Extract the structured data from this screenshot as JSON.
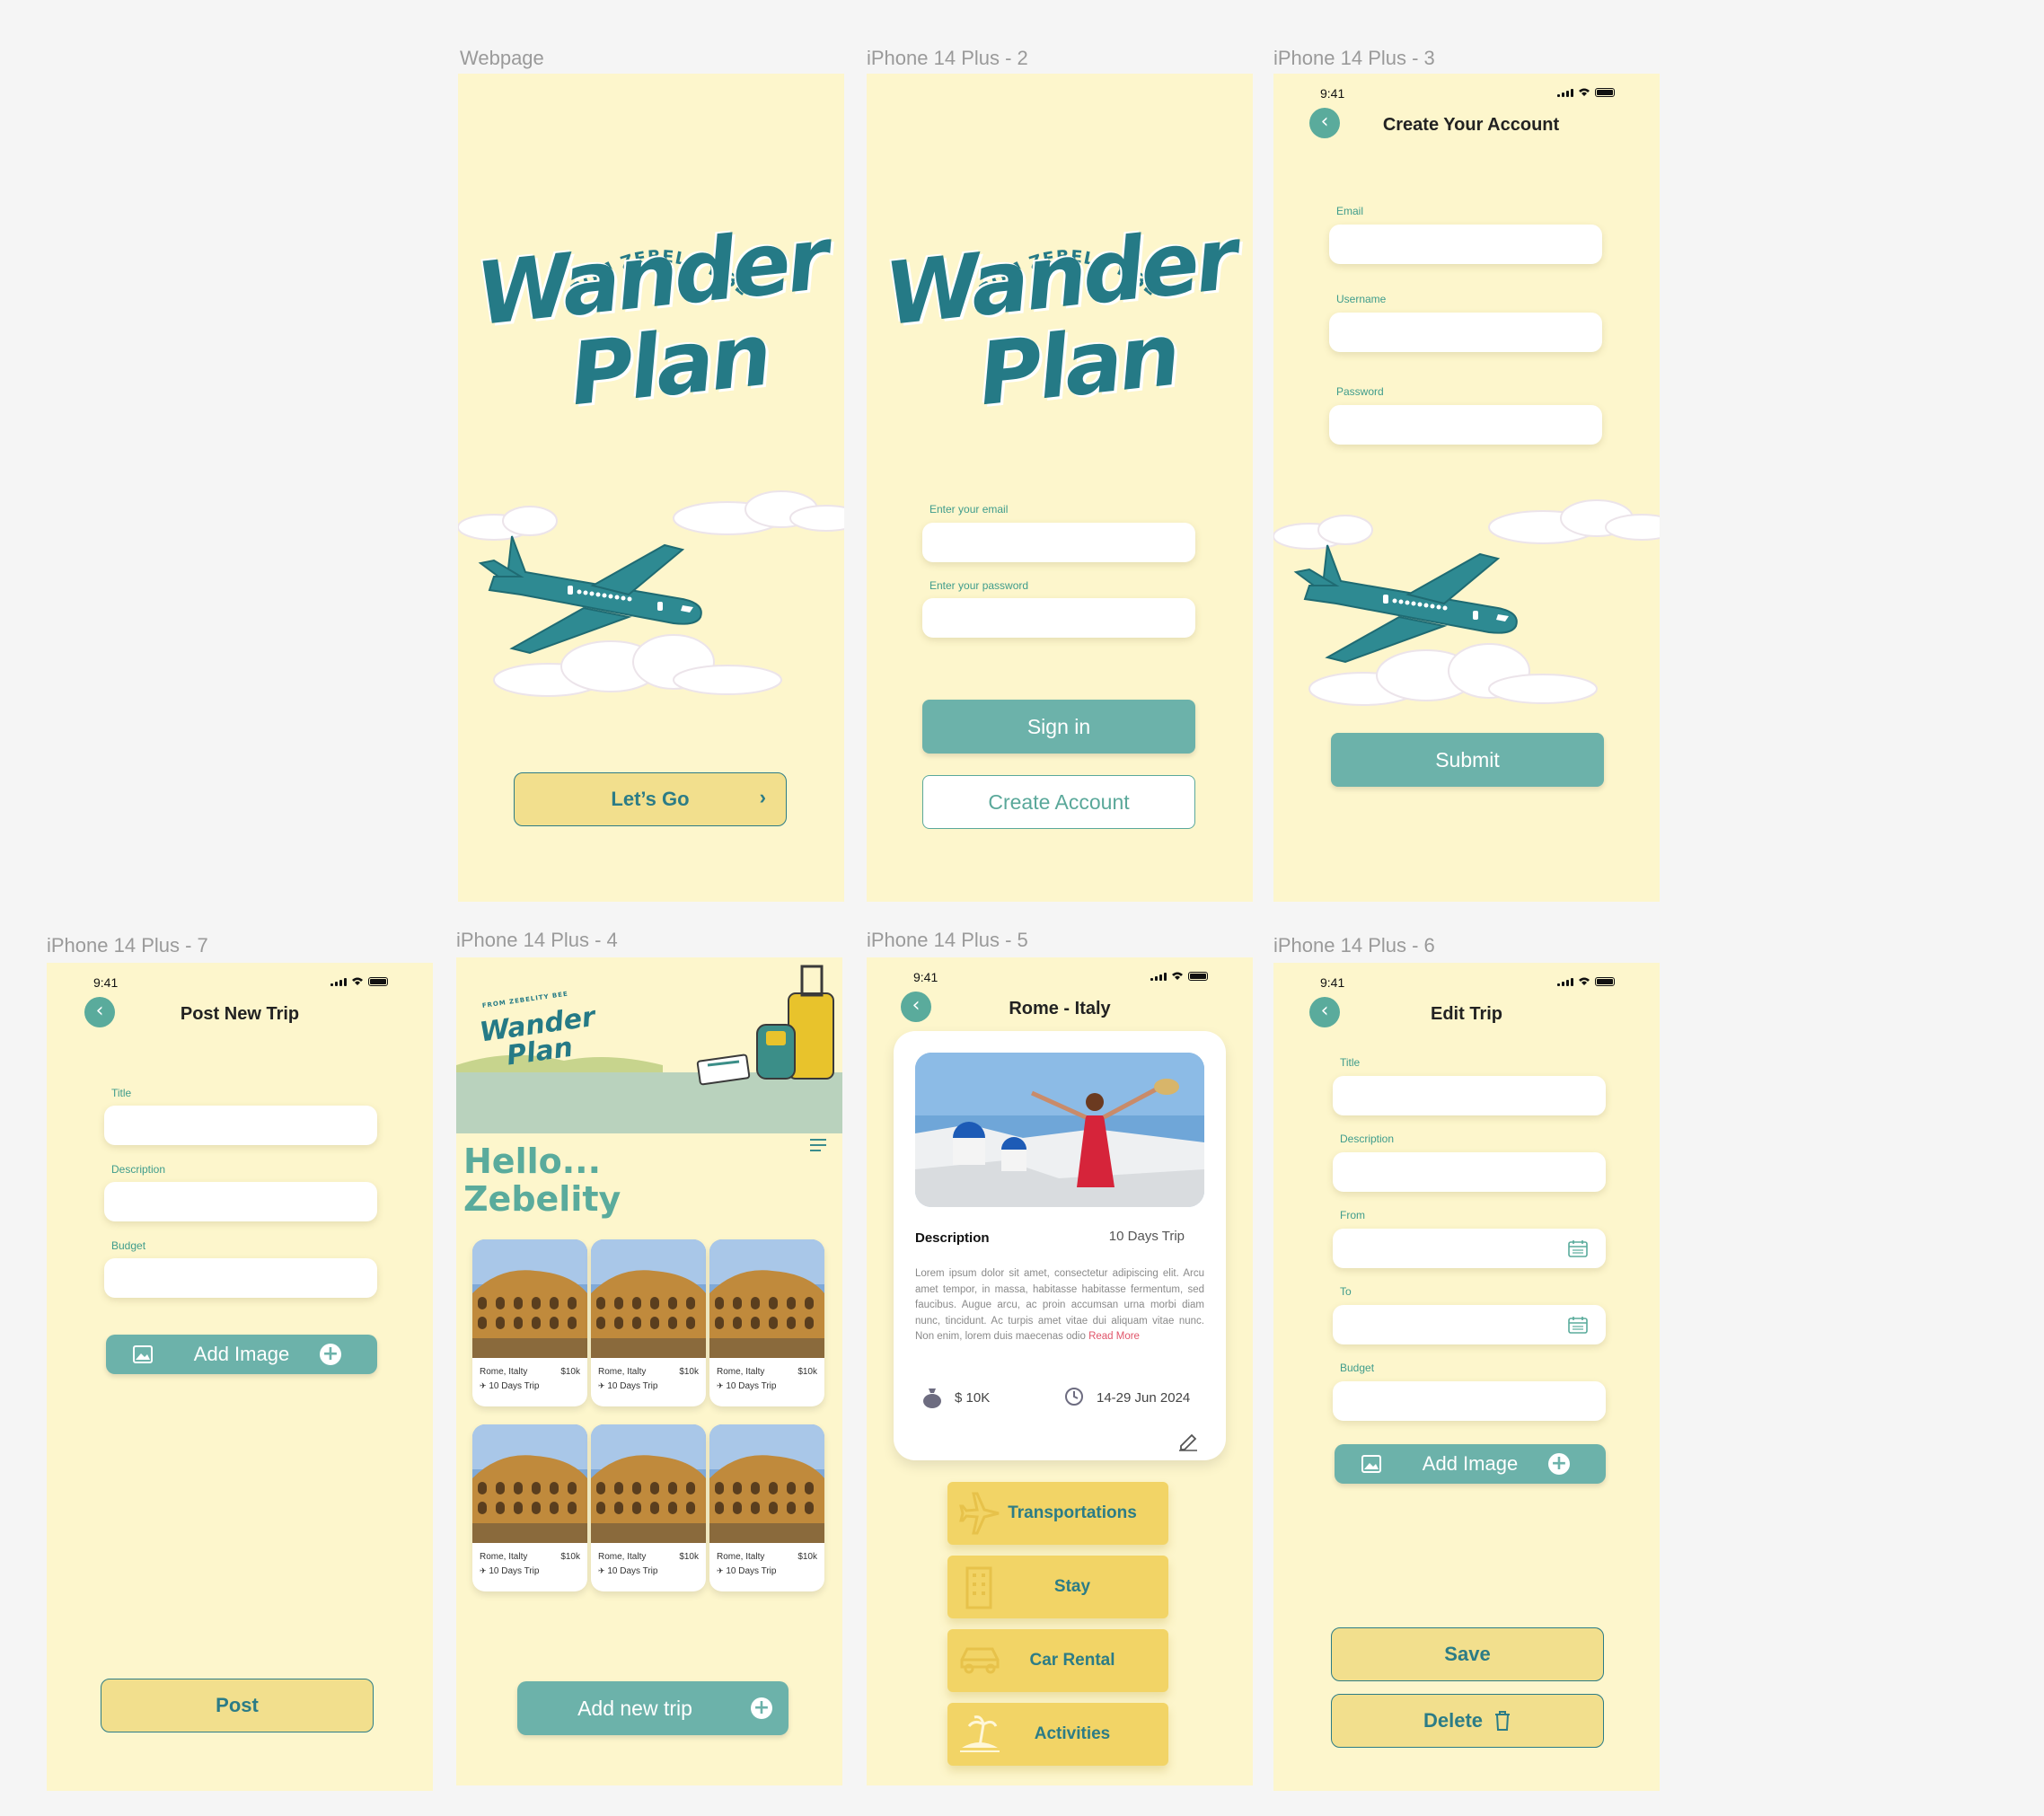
{
  "frames": {
    "webpage": {
      "label": "Webpage",
      "logo_top": "FROM ZEBELITY BEE",
      "logo_line1": "Wander",
      "logo_line2": "Plan",
      "cta_label": "Let’s Go"
    },
    "iphone2": {
      "label": "iPhone 14 Plus - 2",
      "logo_top": "FROM ZEBELITY BEE",
      "logo_line1": "Wander",
      "logo_line2": "Plan",
      "email_label": "Enter your email",
      "password_label": "Enter your password",
      "signin_label": "Sign in",
      "create_label": "Create Account"
    },
    "iphone3": {
      "label": "iPhone 14 Plus - 3",
      "time": "9:41",
      "title": "Create Your Account",
      "email_label": "Email",
      "username_label": "Username",
      "password_label": "Password",
      "submit_label": "Submit"
    },
    "iphone7": {
      "label": "iPhone 14 Plus - 7",
      "time": "9:41",
      "title": "Post New Trip",
      "title_label": "Title",
      "description_label": "Description",
      "budget_label": "Budget",
      "add_image_label": "Add Image",
      "post_label": "Post"
    },
    "iphone4": {
      "label": "iPhone 14 Plus - 4",
      "logo_top": "FROM ZEBELITY BEE",
      "logo_line1": "Wander",
      "logo_line2": "Plan",
      "greeting_line1": "Hello...",
      "greeting_line2": "Zebelity",
      "trips": [
        {
          "city": "Rome, Italty",
          "price": "$10k",
          "days": "10 Days Trip"
        },
        {
          "city": "Rome, Italty",
          "price": "$10k",
          "days": "10 Days Trip"
        },
        {
          "city": "Rome, Italty",
          "price": "$10k",
          "days": "10 Days Trip"
        },
        {
          "city": "Rome, Italty",
          "price": "$10k",
          "days": "10 Days Trip"
        },
        {
          "city": "Rome, Italty",
          "price": "$10k",
          "days": "10 Days Trip"
        },
        {
          "city": "Rome, Italty",
          "price": "$10k",
          "days": "10 Days Trip"
        }
      ],
      "add_trip_label": "Add new trip"
    },
    "iphone5": {
      "label": "iPhone 14 Plus - 5",
      "time": "9:41",
      "title": "Rome - Italy",
      "description_heading": "Description",
      "duration": "10 Days Trip",
      "description_text": "Lorem ipsum dolor sit amet, consectetur adipiscing elit. Arcu amet tempor, in massa, habitasse habitasse fermentum, sed faucibus. Augue arcu, ac proin accumsan urna morbi diam nunc, tincidunt. Ac turpis amet vitae dui aliquam vitae nunc. Non enim, lorem duis maecenas odio",
      "read_more": "Read More",
      "budget": "$ 10K",
      "dates": "14-29 Jun 2024",
      "categories": [
        "Transportations",
        "Stay",
        "Car Rental",
        "Activities"
      ]
    },
    "iphone6": {
      "label": "iPhone 14 Plus - 6",
      "time": "9:41",
      "title": "Edit Trip",
      "title_label": "Title",
      "description_label": "Description",
      "from_label": "From",
      "to_label": "To",
      "budget_label": "Budget",
      "add_image_label": "Add Image",
      "save_label": "Save",
      "delete_label": "Delete"
    }
  },
  "colors": {
    "frame_bg": "#fdf6cc",
    "teal": "#6cb2aa",
    "dark_teal": "#257a86",
    "yellow": "#f2df8d",
    "gold": "#f2d466",
    "canvas": "#f5f5f5"
  },
  "icons": [
    "back-chevron-icon",
    "image-icon",
    "plus-circle-icon",
    "calendar-icon",
    "trash-icon",
    "plane-icon",
    "building-icon",
    "car-icon",
    "island-icon",
    "menu-icon",
    "edit-pencil-icon",
    "money-bag-icon",
    "clock-icon",
    "chevron-right-icon"
  ]
}
